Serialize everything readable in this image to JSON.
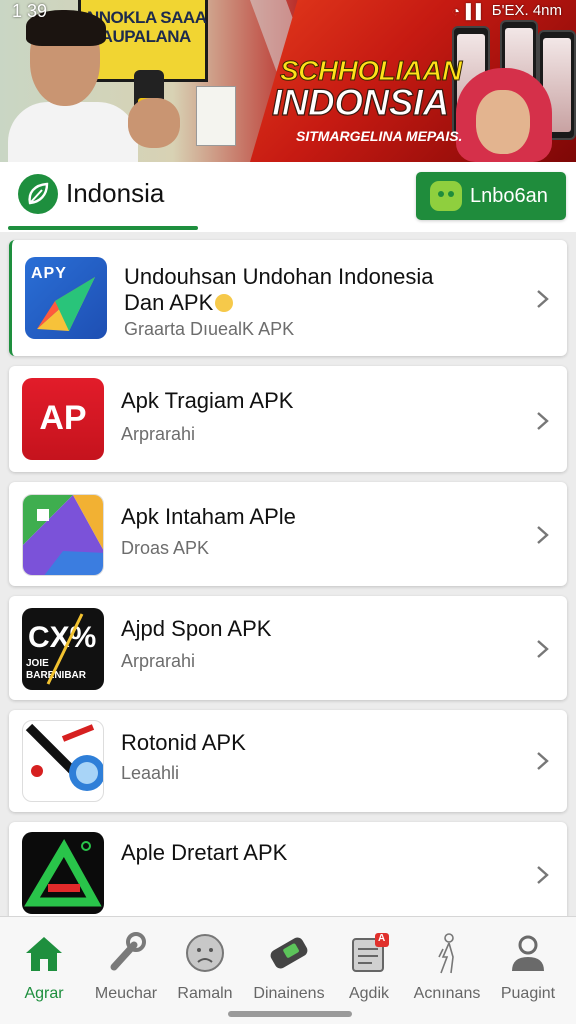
{
  "status_bar": {
    "time": "1 39",
    "right_text": "Б'ЕХ. 4nm"
  },
  "banner": {
    "sign_text": "NNOKLA SAAA MAUPALANA",
    "headline_top": "SCHHOLIAAN",
    "headline_main": "INDONSIA",
    "headline_sub": "SITMARGELINA MEPAIS."
  },
  "header": {
    "title": "Indonsia",
    "button_label": "Lnbo6an"
  },
  "apps": [
    {
      "name": "Undouhsan Undohan Indonesia",
      "name_line2": "Dan APK",
      "subtitle": "Graarta Dıueal‌K APK",
      "icon": "paper-plane-icon",
      "icon_text": "APY"
    },
    {
      "name": "Apk Tragiam APK",
      "subtitle": "Arprarahi",
      "icon": "ap-icon",
      "icon_text": "AP"
    },
    {
      "name": "Apk Intaham APle",
      "subtitle": "Droas APK",
      "icon": "gallery-icon",
      "icon_text": ""
    },
    {
      "name": "Ajpd Spon APK",
      "subtitle": "Arprarahi",
      "icon": "cx-icon",
      "icon_text": "CX%",
      "icon_subtext": "JOIE BARENIBAR"
    },
    {
      "name": "Rotonid APK",
      "subtitle": "Leaahli",
      "icon": "shield-icon",
      "icon_text": ""
    },
    {
      "name": "Aple Dretart APK",
      "subtitle": "",
      "icon": "triangle-a-icon",
      "icon_text": ""
    }
  ],
  "bottom_nav": [
    {
      "label": "Agrar",
      "icon": "home-icon",
      "active": true
    },
    {
      "label": "Meuchar",
      "icon": "wrench-icon",
      "active": false
    },
    {
      "label": "Ramaln",
      "icon": "face-icon",
      "active": false
    },
    {
      "label": "Dinainens",
      "icon": "device-icon",
      "active": false
    },
    {
      "label": "Agdik",
      "icon": "clipboard-icon",
      "active": false,
      "badge": "A"
    },
    {
      "label": "Acnınans",
      "icon": "figure-icon",
      "active": false
    },
    {
      "label": "Puagint",
      "icon": "person-icon",
      "active": false
    }
  ],
  "colors": {
    "accent": "#1e8f3e",
    "banner_red": "#c61a12",
    "headline_yellow": "#ffe21a"
  }
}
